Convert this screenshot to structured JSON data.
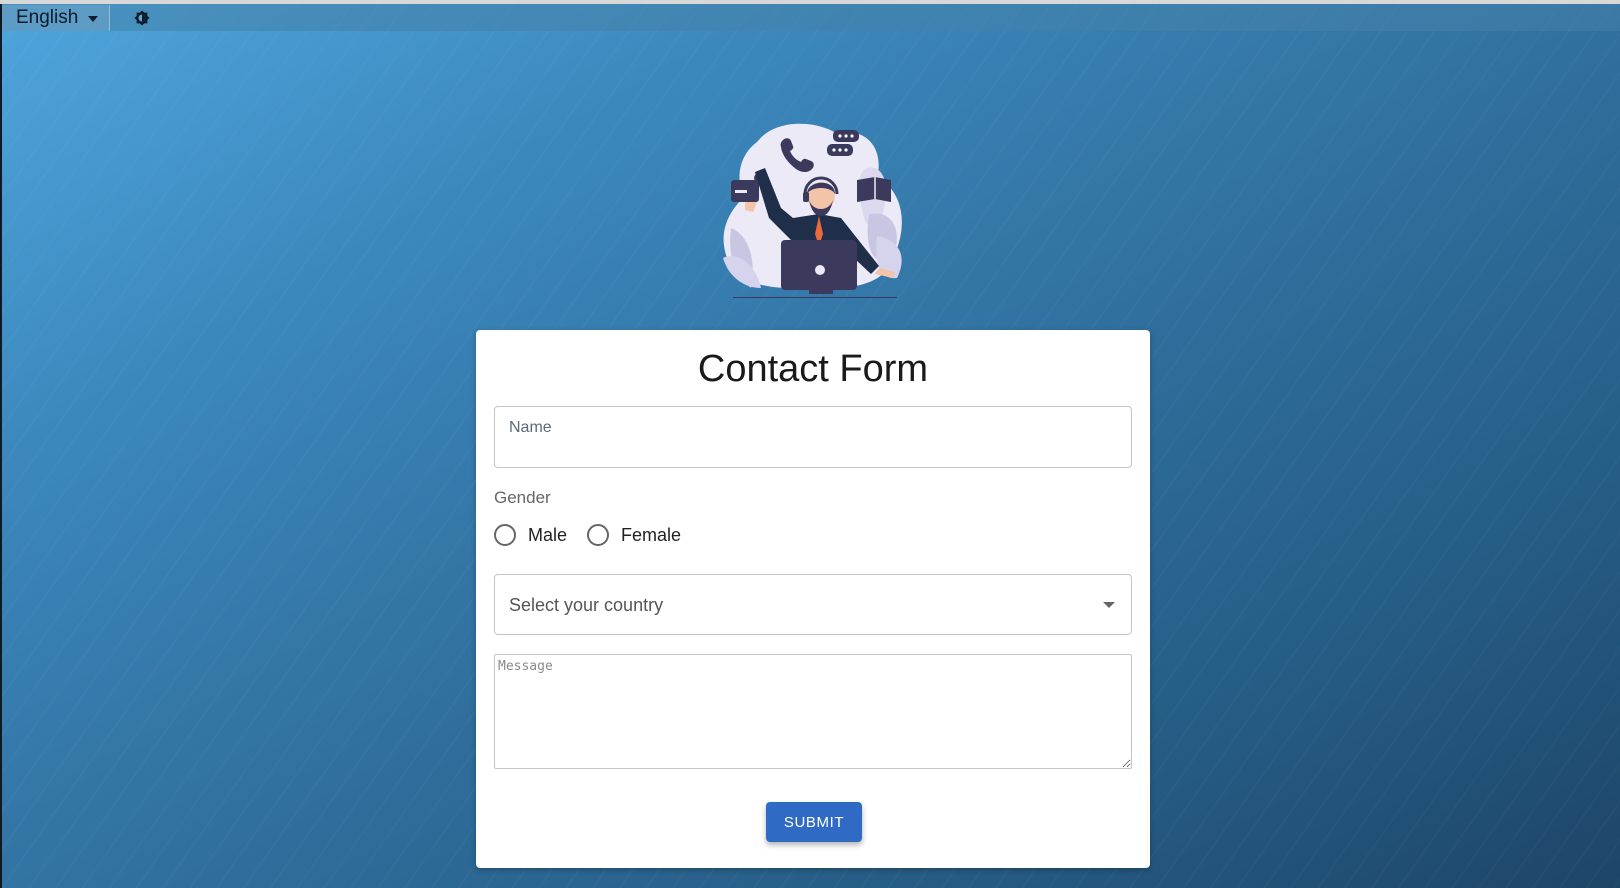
{
  "topbar": {
    "language": "English",
    "theme_toggle_icon": "brightness-icon"
  },
  "illustration": {
    "icon": "customer-support-illustration"
  },
  "form": {
    "title": "Contact Form",
    "name_label": "Name",
    "gender_label": "Gender",
    "gender_options": [
      "Male",
      "Female"
    ],
    "country_placeholder": "Select your country",
    "message_placeholder": "Message",
    "submit_label": "SUBMIT"
  },
  "colors": {
    "accent": "#2f6bc4",
    "background_top": "#4ea6dc",
    "background_bottom": "#1d4568"
  }
}
